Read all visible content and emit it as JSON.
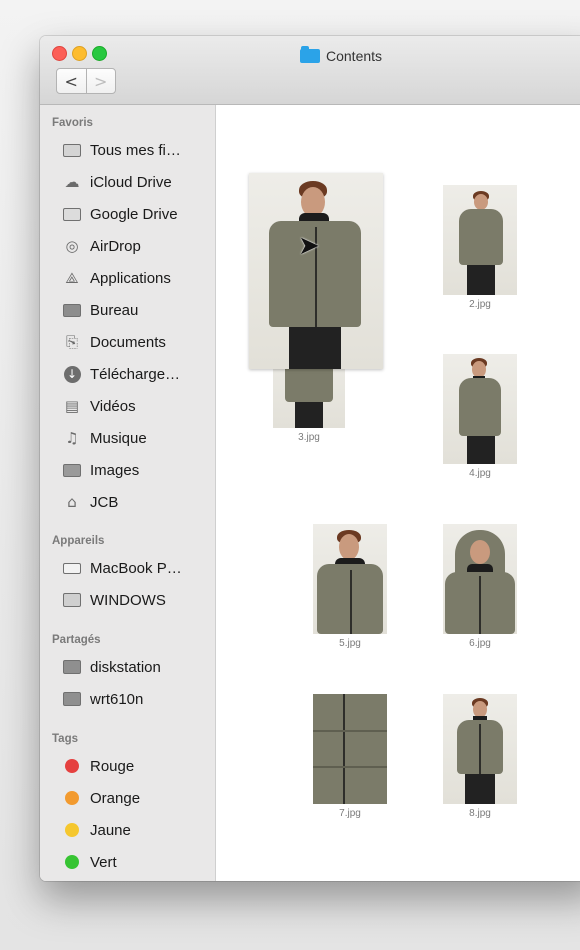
{
  "window": {
    "title": "Contents",
    "nav_back": "<",
    "nav_forward": ">"
  },
  "sidebar": {
    "sections": [
      {
        "title": "Favoris",
        "items": [
          {
            "label": "Tous mes fi…",
            "icon": "all-files-icon"
          },
          {
            "label": "iCloud Drive",
            "icon": "cloud-icon"
          },
          {
            "label": "Google Drive",
            "icon": "folder-icon"
          },
          {
            "label": "AirDrop",
            "icon": "airdrop-icon"
          },
          {
            "label": "Applications",
            "icon": "applications-icon"
          },
          {
            "label": "Bureau",
            "icon": "desktop-icon"
          },
          {
            "label": "Documents",
            "icon": "documents-icon"
          },
          {
            "label": "Télécharge…",
            "icon": "downloads-icon"
          },
          {
            "label": "Vidéos",
            "icon": "film-icon"
          },
          {
            "label": "Musique",
            "icon": "music-icon"
          },
          {
            "label": "Images",
            "icon": "camera-icon"
          },
          {
            "label": "JCB",
            "icon": "home-icon"
          }
        ]
      },
      {
        "title": "Appareils",
        "items": [
          {
            "label": "MacBook P…",
            "icon": "laptop-icon"
          },
          {
            "label": "WINDOWS",
            "icon": "disk-icon"
          }
        ]
      },
      {
        "title": "Partagés",
        "items": [
          {
            "label": "diskstation",
            "icon": "monitor-icon"
          },
          {
            "label": "wrt610n",
            "icon": "monitor-icon"
          }
        ]
      },
      {
        "title": "Tags",
        "items": [
          {
            "label": "Rouge",
            "color": "#e5403f"
          },
          {
            "label": "Orange",
            "color": "#f29a2f"
          },
          {
            "label": "Jaune",
            "color": "#f5c72e"
          },
          {
            "label": "Vert",
            "color": "#37c433"
          }
        ]
      }
    ]
  },
  "files": [
    {
      "name": "",
      "pose": "front-large"
    },
    {
      "name": "2.jpg",
      "pose": "side"
    },
    {
      "name": "3.jpg",
      "pose": "back"
    },
    {
      "name": "4.jpg",
      "pose": "three-quarter"
    },
    {
      "name": "5.jpg",
      "pose": "portrait"
    },
    {
      "name": "6.jpg",
      "pose": "hood-up"
    },
    {
      "name": "7.jpg",
      "pose": "detail"
    },
    {
      "name": "8.jpg",
      "pose": "front"
    }
  ],
  "colors": {
    "folder": "#2ba3e8",
    "jacket": "#7b7b69"
  }
}
